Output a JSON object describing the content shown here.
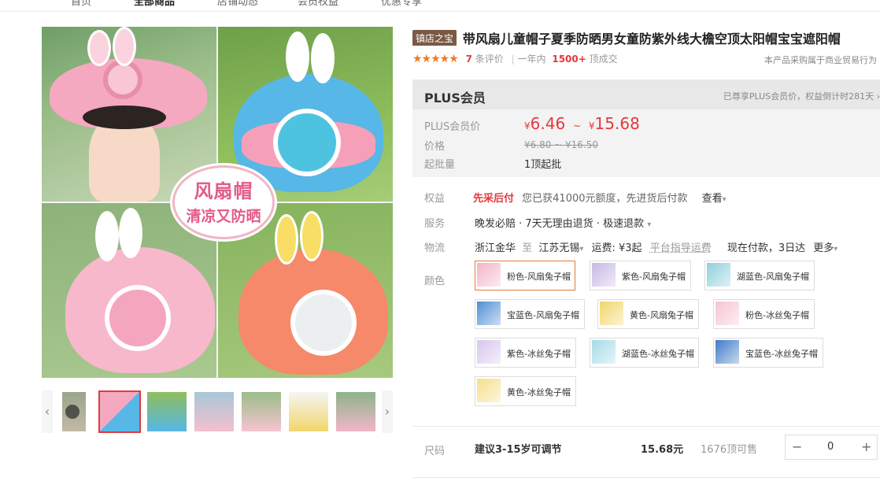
{
  "topnav": [
    "首页",
    "全部商品",
    "店铺动态",
    "会员权益",
    "优惠专享"
  ],
  "gallery": {
    "banner_line1": "风扇帽",
    "banner_line2": "清凉又防晒",
    "prev_arrow": "‹",
    "next_arrow": "›"
  },
  "product": {
    "shop_badge": "镇店之宝",
    "title": "带风扇儿童帽子夏季防晒男女童防紫外线大檐空顶太阳帽宝宝遮阳帽",
    "stars": "★★★★★",
    "review_count": "7",
    "review_suffix": "条评价",
    "sold_prefix": "一年内",
    "sold_count": "1500+",
    "sold_suffix": "顶成交",
    "purchase_note": "本产品采购属于商业贸易行为"
  },
  "pricebox": {
    "plus_title": "PLUS会员",
    "plus_note": "已尊享PLUS会员价，权益倒计时281天 ›",
    "plus_price_label": "PLUS会员价",
    "plus_price_low": "6.46",
    "plus_price_high": "15.68",
    "price_sep": "~",
    "currency": "¥",
    "price_label": "价格",
    "price_original": "¥6.80 ~ ¥16.50",
    "moq_label": "起批量",
    "moq_value": "1顶起批"
  },
  "rows": {
    "rights_label": "权益",
    "rights_tag": "先采后付",
    "rights_text": "您已获41000元额度，先进货后付款",
    "rights_link": "查看",
    "service_label": "服务",
    "service_text": "晚发必赔 · 7天无理由退货 · 极速退款",
    "logistics_label": "物流",
    "from": "浙江金华",
    "to_word": "至",
    "to": "江苏无锡",
    "freight": "运费: ¥3起",
    "freight_guide": "平台指导运费",
    "ship_time": "现在付款，3日达",
    "more": "更多",
    "color_label": "颜色"
  },
  "colors": [
    {
      "label": "粉色-风扇兔子帽",
      "swatch": "#f2b6c8"
    },
    {
      "label": "紫色-风扇兔子帽",
      "swatch": "#c8b8e4"
    },
    {
      "label": "湖蓝色-风扇兔子帽",
      "swatch": "#8fd0dc"
    },
    {
      "label": "宝蓝色-风扇兔子帽",
      "swatch": "#4f8fd6"
    },
    {
      "label": "黄色-风扇兔子帽",
      "swatch": "#f2d66a"
    },
    {
      "label": "粉色-冰丝兔子帽",
      "swatch": "#f6c4d2"
    },
    {
      "label": "紫色-冰丝兔子帽",
      "swatch": "#d7c6ee"
    },
    {
      "label": "湖蓝色-冰丝兔子帽",
      "swatch": "#a6dbe6"
    },
    {
      "label": "宝蓝色-冰丝兔子帽",
      "swatch": "#3f7cc8"
    },
    {
      "label": "黄色-冰丝兔子帽",
      "swatch": "#f5e08a"
    }
  ],
  "size": {
    "label": "尺码",
    "option": "建议3-15岁可调节",
    "price": "15.68元",
    "stock": "1676顶可售",
    "minus": "−",
    "qty": "0",
    "plus": "+"
  }
}
